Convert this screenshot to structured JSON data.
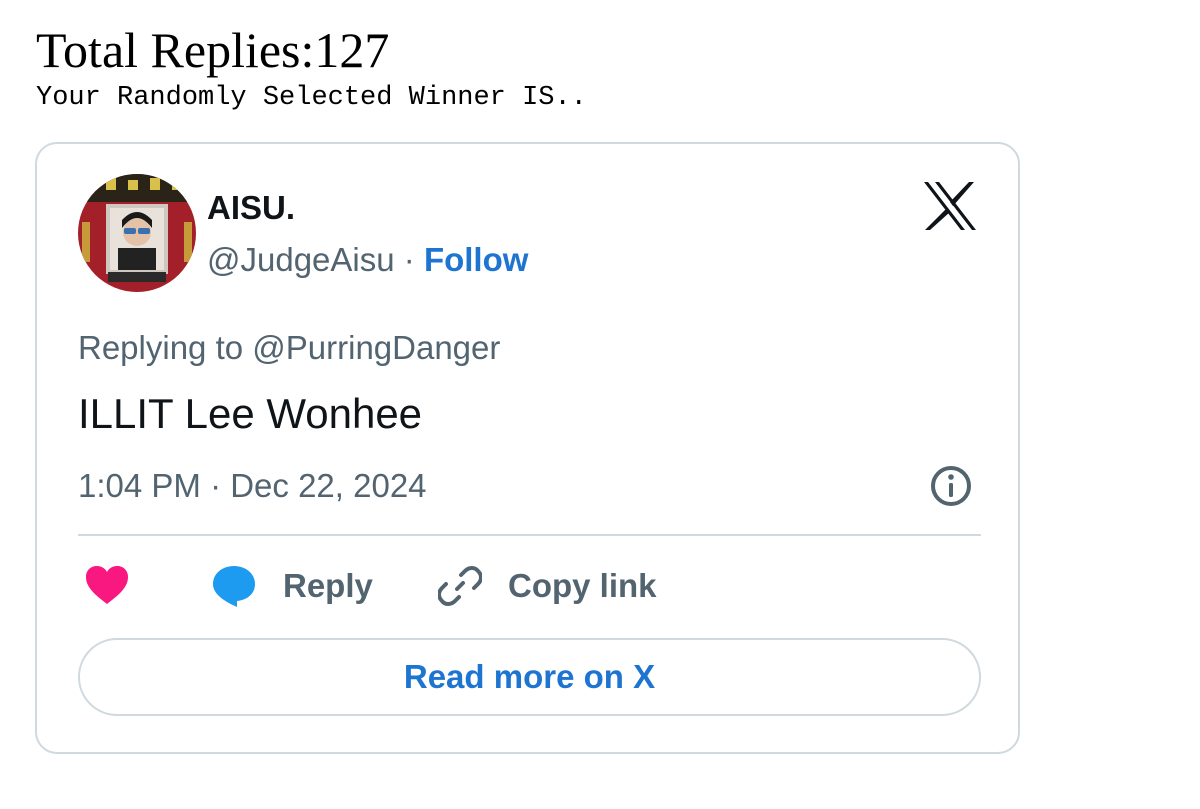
{
  "header": {
    "total_replies": "Total Replies:127",
    "winner_line": "Your Randomly Selected Winner IS.."
  },
  "tweet": {
    "author": {
      "name": "AISU.",
      "handle": "@JudgeAisu",
      "separator": " · ",
      "follow_label": "Follow"
    },
    "replying_to": "Replying to @PurringDanger",
    "text": "ILLIT Lee Wonhee",
    "timestamp": "1:04 PM · Dec 22, 2024",
    "actions": {
      "reply_label": "Reply",
      "copy_link_label": "Copy link"
    },
    "read_more_label": "Read more on X"
  },
  "icons": {
    "brand": "x-logo-icon",
    "info": "info-icon",
    "like": "heart-icon",
    "reply": "speech-bubble-icon",
    "copy_link": "link-icon"
  },
  "colors": {
    "link_blue": "#1d74d1",
    "heart_pink": "#f91880",
    "reply_blue": "#1d9bf0",
    "secondary_text": "#536471",
    "border": "#cfd9de"
  }
}
